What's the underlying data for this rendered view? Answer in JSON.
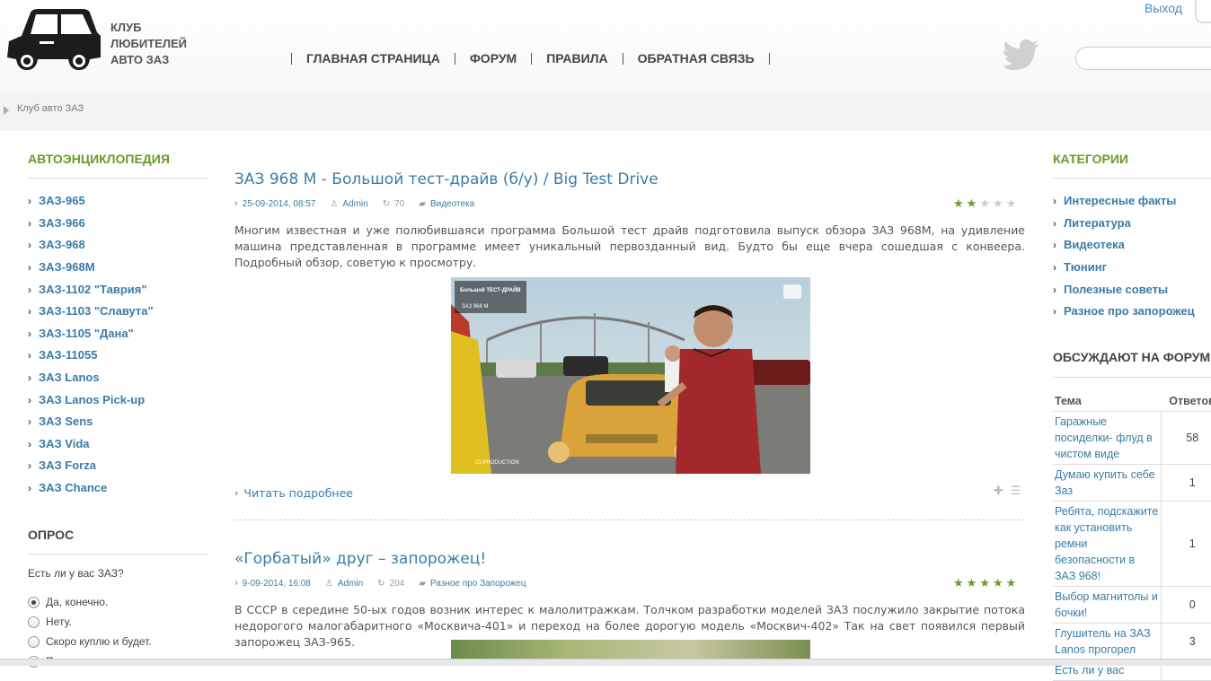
{
  "header": {
    "logo_lines": [
      "Клуб",
      "любителей",
      "авто ЗАЗ"
    ],
    "nav": [
      "ГЛАВНАЯ СТРАНИЦА",
      "ФОРУМ",
      "ПРАВИЛА",
      "ОБРАТНАЯ СВЯЗЬ"
    ],
    "exit_label": "Выход",
    "search_placeholder": ""
  },
  "breadcrumb": {
    "item": "Клуб авто ЗАЗ"
  },
  "left_sidebar": {
    "encyclopedia_title": "АВТОЭНЦИКЛОПЕДИЯ",
    "models": [
      "ЗАЗ-965",
      "ЗАЗ-966",
      "ЗАЗ-968",
      "ЗАЗ-968М",
      "ЗАЗ-1102 \"Таврия\"",
      "ЗАЗ-1103 \"Славута\"",
      "ЗАЗ-1105 \"Дана\"",
      "ЗАЗ-11055",
      "ЗАЗ Lanos",
      "ЗАЗ Lanos Pick-up",
      "ЗАЗ Sens",
      "ЗАЗ Vida",
      "ЗАЗ Forza",
      "ЗАЗ Chance"
    ],
    "poll_title": "ОПРОС",
    "poll_question": "Есть ли у вас ЗАЗ?",
    "poll_options": [
      "Да, конечно.",
      "Нету.",
      "Скоро куплю и будет.",
      "Пока нет."
    ],
    "poll_selected": 0
  },
  "posts": [
    {
      "title": "ЗАЗ 968 М - Большой тест-драйв (б/у) / Big Test Drive",
      "date": "25-09-2014, 08:57",
      "author": "Admin",
      "views": "70",
      "category": "Видеотека",
      "rating": 2,
      "text": "Многим известная и уже полюбившаяси программа Большой тест драйв подготовила выпуск обзора ЗАЗ 968М, на удивление машина представленная в программе имеет уникальный первозданный вид. Будто бы еще вчера сошедшая с конвеера. Подробный обзор, советую к просмотру.",
      "read_more": "Читать подробнее",
      "video_logo": "Большой ТЕСТ-ДРАЙВ",
      "video_sub": "ЗАЗ 968 М",
      "video_credit": "03 PRODUCTION"
    },
    {
      "title": "«Горбатый» друг – запорожец!",
      "date": "9-09-2014, 16:08",
      "author": "Admin",
      "views": "204",
      "category": "Разное про Запорожец",
      "rating": 5,
      "text": "В СССР в середине 50-ых годов возник интерес к малолитражкам. Толчком разработки моделей ЗАЗ послужило закрытие потока недорогого малогабаритного «Москвича-401» и переход на более дорогую модель «Москвич-402» Так на свет появился первый запорожец ЗАЗ-965."
    }
  ],
  "right_sidebar": {
    "categories_title": "КАТЕГОРИИ",
    "categories": [
      "Интересные факты",
      "Литература",
      "Видеотека",
      "Тюнинг",
      "Полезные советы",
      "Разное про запорожец"
    ],
    "forum_title": "ОБСУЖДАЮТ НА ФОРУМЕ",
    "forum_headers": [
      "Тема",
      "Ответов"
    ],
    "forum_rows": [
      {
        "topic": "Гаражные посиделки- флуд в чистом виде",
        "replies": "58"
      },
      {
        "topic": "Думаю купить себе Заз",
        "replies": "1"
      },
      {
        "topic": "Ребята, подскажите как установить ремни безопасности в ЗАЗ 968!",
        "replies": "1"
      },
      {
        "topic": "Выбор магнитолы и бочки!",
        "replies": "0"
      },
      {
        "topic": "Глушитель на ЗАЗ Lanos прогорел",
        "replies": "3"
      },
      {
        "topic": "Есть ли у вас",
        "replies": ""
      }
    ]
  },
  "colors": {
    "accent_green": "#6a9a2a",
    "link_blue": "#3a7ca8",
    "star_on": "#6a9a2a",
    "star_off": "#cccccc"
  }
}
